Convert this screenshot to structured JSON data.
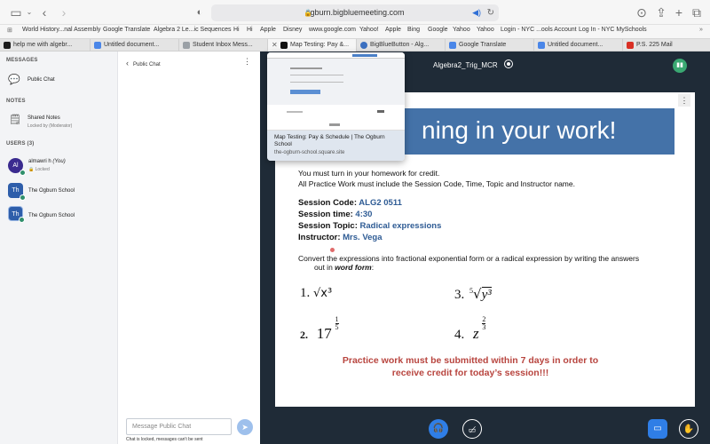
{
  "browser": {
    "url": "ogburn.bigbluemeeting.com",
    "favorites": [
      "World History...nal Assembly",
      "Google Translate",
      "Algebra 2 Le...ic Sequences",
      "Hi",
      "Hi",
      "Apple",
      "Disney",
      "www.google.com",
      "Yahoo!",
      "Apple",
      "Bing",
      "Google",
      "Yahoo",
      "Yahoo",
      "Login - NYC ...ools Account",
      "Log In - NYC MySchools"
    ],
    "tabs": [
      {
        "label": "help me with algebr...",
        "color": "#1a1a1a"
      },
      {
        "label": "Untitled document...",
        "color": "#4a86e8"
      },
      {
        "label": "Student Inbox Mess...",
        "color": "#9aa0a6"
      },
      {
        "label": "Map Testing: Pay &...",
        "color": "#111111"
      },
      {
        "label": "BigBlueButton - Alg...",
        "color": "#3a6fc0"
      },
      {
        "label": "Google Translate",
        "color": "#4a86e8"
      },
      {
        "label": "Untitled document...",
        "color": "#4a86e8"
      },
      {
        "label": "P.S. 225 Mail",
        "color": "#d93025"
      }
    ]
  },
  "sidebar": {
    "messages_title": "MESSAGES",
    "public_chat": "Public Chat",
    "notes_title": "NOTES",
    "shared_notes": "Shared Notes",
    "shared_notes_sub": "Locked by (Moderator)",
    "users_title": "USERS (3)",
    "users": [
      {
        "initials": "Al",
        "name": "almawri h",
        "you": "(You)",
        "sub": "Locked",
        "color": "#3b2b8f"
      },
      {
        "initials": "Th",
        "name": "The Ogburn School",
        "sub": "",
        "color": "#2e5eaa"
      },
      {
        "initials": "Th",
        "name": "The Ogburn School",
        "sub": "",
        "color": "#2e5eaa"
      }
    ]
  },
  "chat": {
    "header": "Public Chat",
    "placeholder": "Message Public Chat",
    "locked": "Chat is locked, messages can't be sent"
  },
  "meeting": {
    "title": "Algebra2_Trig_MCR"
  },
  "popup": {
    "title": "Map Testing: Pay & Schedule | The Ogburn School",
    "url": "the-ogburn-school.square.site"
  },
  "slide": {
    "banner": "ning in your work!",
    "line1": "You must turn in your homework for credit.",
    "line2": "All Practice Work must include the Session Code, Time, Topic and Instructor name.",
    "code_label": "Session Code:",
    "code_value": "ALG2 0511",
    "time_label": "Session time:",
    "time_value": "4:30",
    "topic_label": "Session Topic:",
    "topic_value": "Radical expressions",
    "instructor_label": "Instructor:",
    "instructor_value": "Mrs. Vega",
    "instructions_1": "Convert the expressions into fractional exponential form or a radical expression by writing the answers",
    "instructions_2_pre": "out in",
    "instructions_2_em": "word form",
    "instructions_2_post": ":",
    "problems": {
      "p1_num": "1.",
      "p1_expr": "√x³",
      "p2_num": "2.",
      "p2_base": "17",
      "p2_num_exp": "1",
      "p2_den_exp": "5",
      "p3_num": "3.",
      "p3_index": "5",
      "p3_rad": "y³",
      "p4_num": "4.",
      "p4_base": "z",
      "p4_num_exp": "2",
      "p4_den_exp": "3"
    },
    "warning_1": "Practice work must be submitted within 7 days in order to",
    "warning_2": "receive credit for today’s session!!!"
  },
  "colors": {
    "accent": "#2f7ee6",
    "banner": "#4472a8",
    "warning": "#b8453f",
    "stage": "#1f2b37"
  }
}
